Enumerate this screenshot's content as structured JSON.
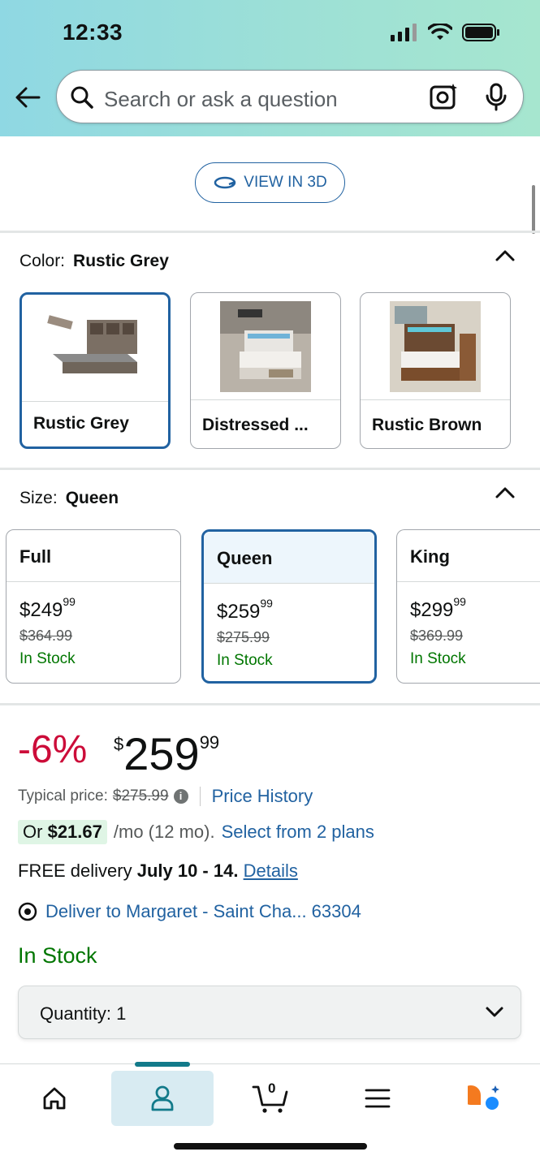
{
  "status_bar": {
    "time": "12:33"
  },
  "search": {
    "placeholder": "Search or ask a question"
  },
  "view3d": {
    "label": "VIEW IN 3D"
  },
  "color_section": {
    "label": "Color:",
    "selected": "Rustic Grey",
    "options": [
      {
        "label": "Rustic Grey"
      },
      {
        "label": "Distressed ..."
      },
      {
        "label": "Rustic Brown"
      }
    ]
  },
  "size_section": {
    "label": "Size:",
    "selected": "Queen",
    "options": [
      {
        "name": "Full",
        "price_whole": "$249",
        "price_cents": "99",
        "list_price": "$364.99",
        "stock": "In Stock"
      },
      {
        "name": "Queen",
        "price_whole": "$259",
        "price_cents": "99",
        "list_price": "$275.99",
        "stock": "In Stock"
      },
      {
        "name": "King",
        "price_whole": "$299",
        "price_cents": "99",
        "list_price": "$369.99",
        "stock": "In Stock"
      }
    ]
  },
  "pricing": {
    "discount": "-6%",
    "currency": "$",
    "whole": "259",
    "cents": "99",
    "typical_label": "Typical price:",
    "typical_value": "$275.99",
    "price_history": "Price History",
    "monthly_prefix": "Or",
    "monthly_amount": "$21.67",
    "monthly_suffix": "/mo (12 mo).",
    "monthly_link": "Select from 2 plans"
  },
  "delivery": {
    "prefix": "FREE delivery",
    "dates": "July 10 - 14.",
    "details": "Details",
    "deliver_to": "Deliver to Margaret - Saint Cha... 63304"
  },
  "availability": "In Stock",
  "quantity": {
    "label": "Quantity: 1"
  },
  "bottom_nav": {
    "cart_count": "0"
  },
  "colors": {
    "accent_blue": "#2162a1",
    "deal_red": "#cc0c39",
    "stock_green": "#007600",
    "teal": "#127a8a"
  }
}
